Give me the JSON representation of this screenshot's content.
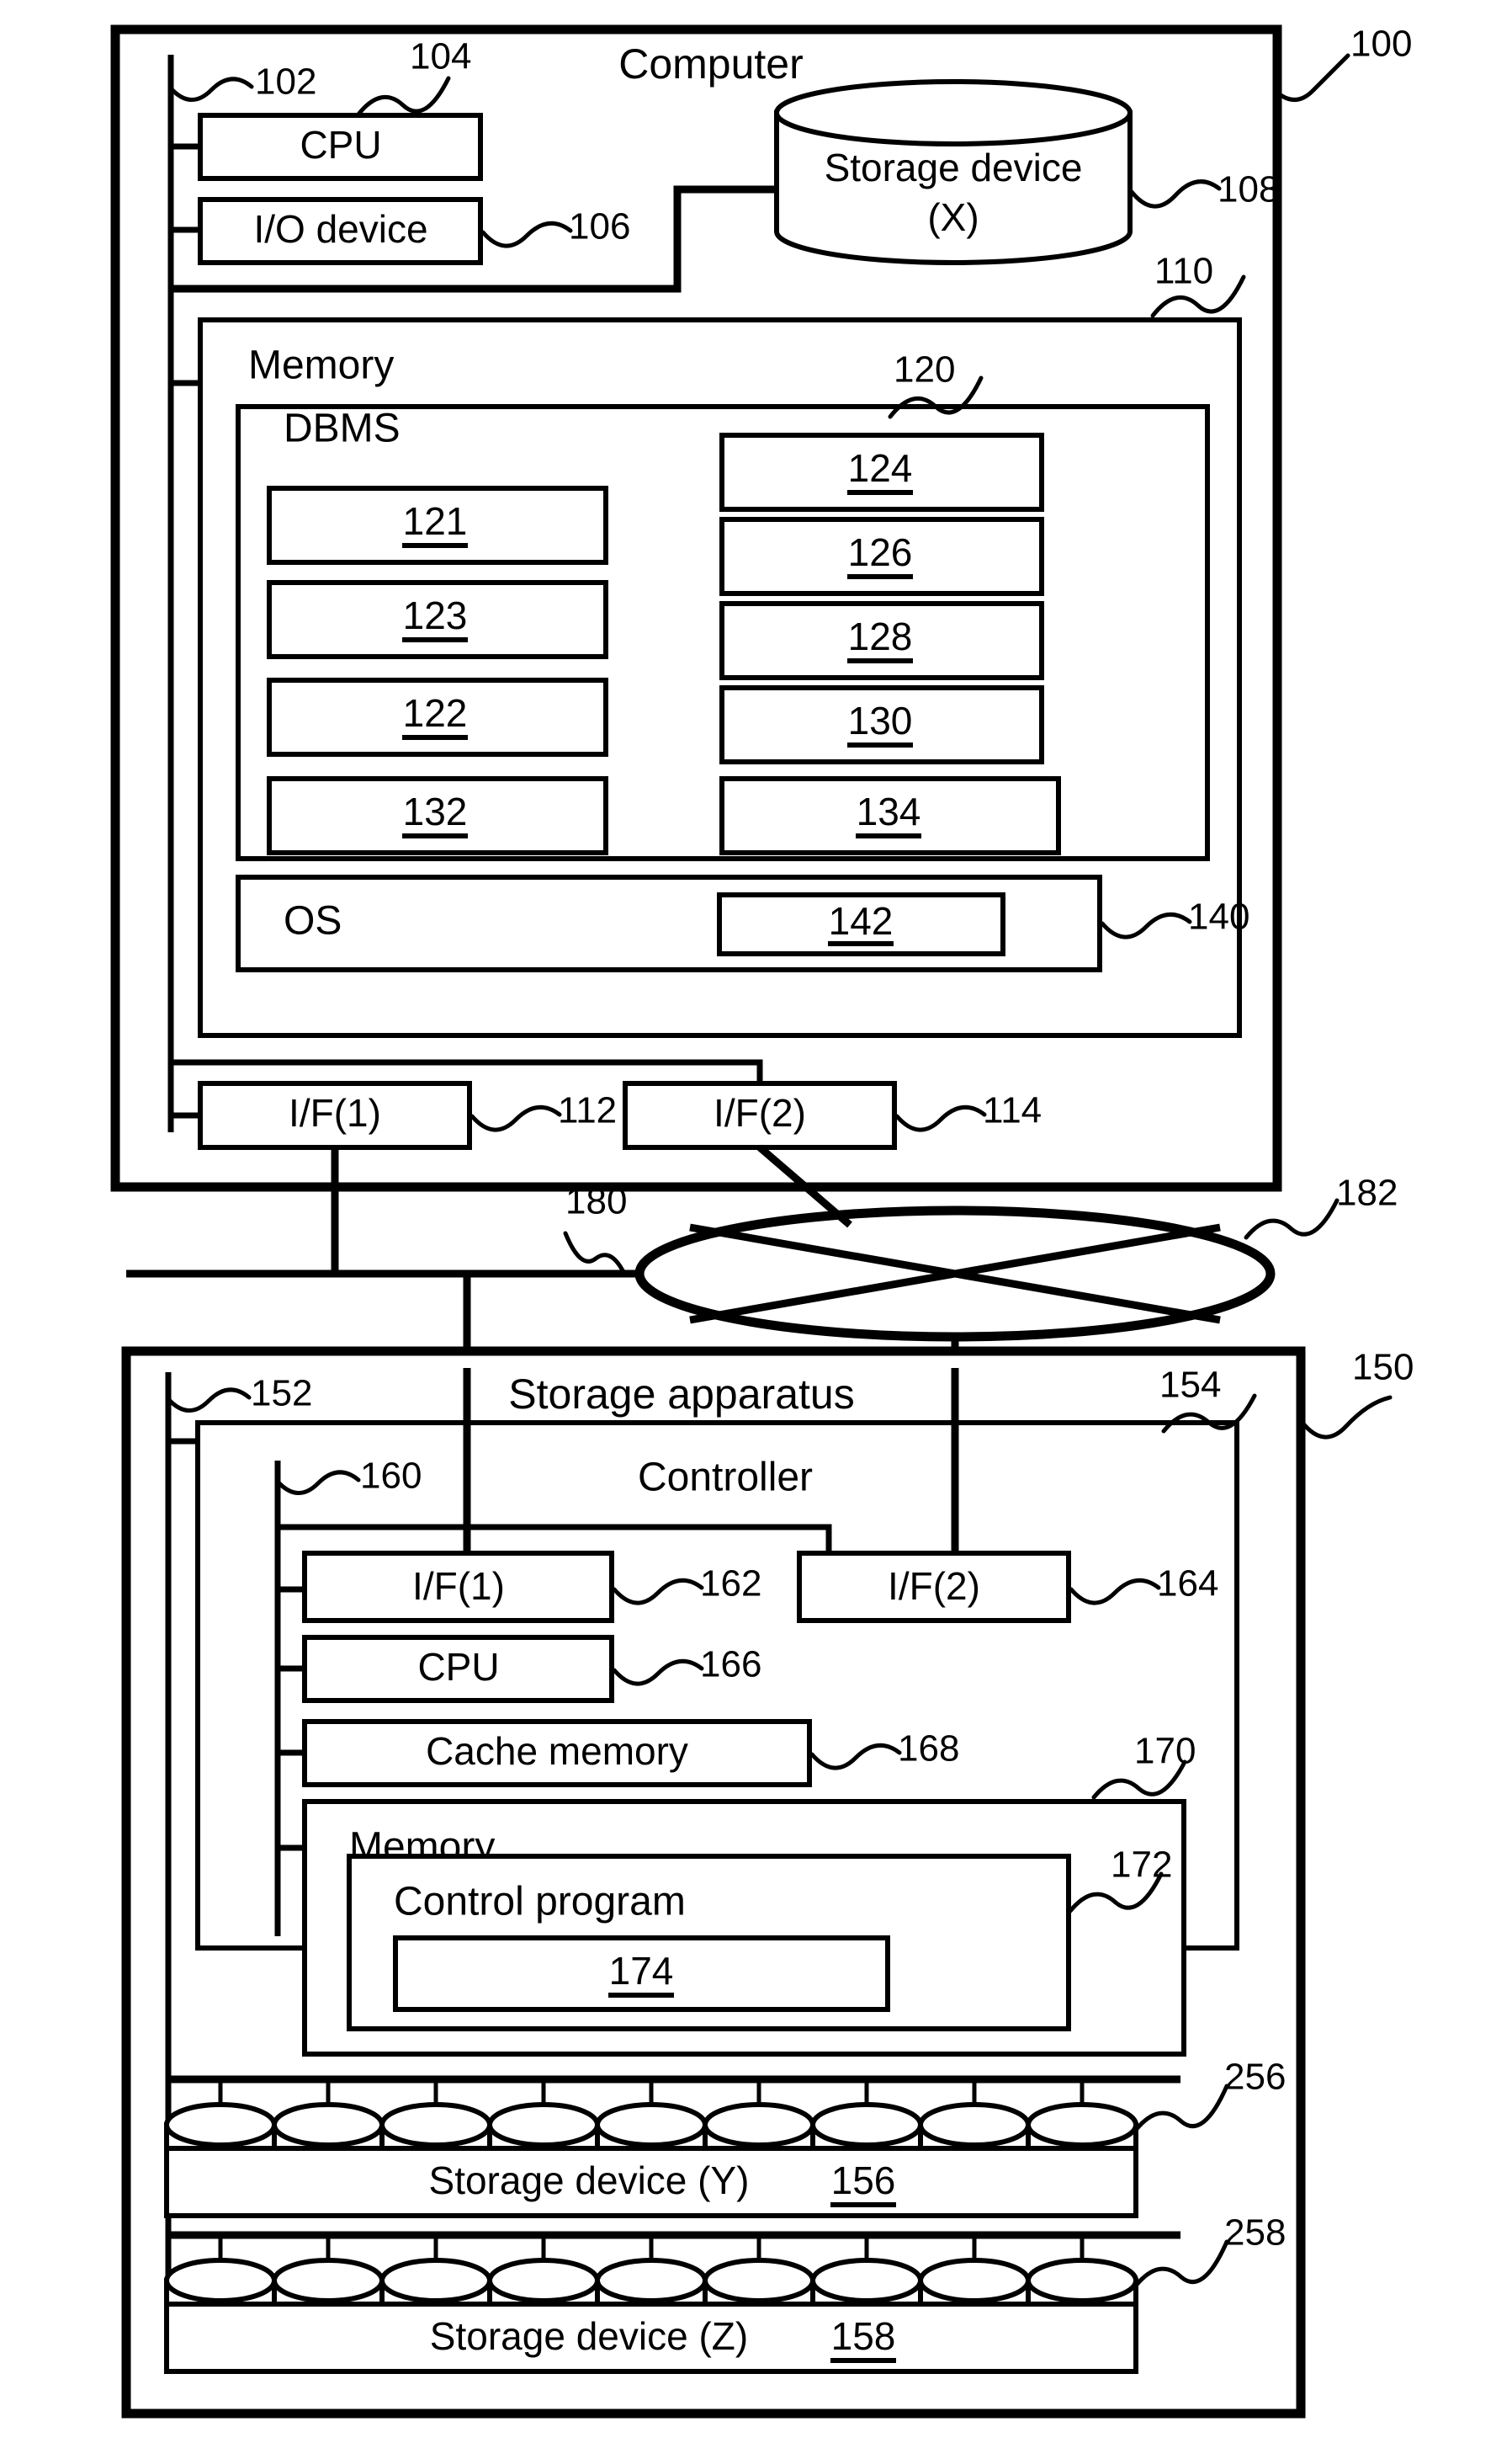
{
  "figure": {
    "top_ref": "100",
    "bottom_ref": "150",
    "network_ref": "182",
    "link_ref": "180"
  },
  "computer": {
    "title": "Computer",
    "bus_ref": "102",
    "cpu": {
      "label": "CPU",
      "ref": "104"
    },
    "io_device": {
      "label": "I/O device",
      "ref": "106"
    },
    "storage_device_x": {
      "line1": "Storage device",
      "line2": "(X)",
      "ref": "108"
    },
    "memory": {
      "label": "Memory",
      "ref": "110",
      "dbms": {
        "label": "DBMS",
        "ref": "120",
        "left_boxes": [
          {
            "ref": "121"
          },
          {
            "ref": "123"
          },
          {
            "ref": "122"
          },
          {
            "ref": "132"
          }
        ],
        "right_boxes": [
          {
            "ref": "124"
          },
          {
            "ref": "126"
          },
          {
            "ref": "128"
          },
          {
            "ref": "130"
          },
          {
            "ref": "134"
          }
        ]
      },
      "os": {
        "label": "OS",
        "ref": "140",
        "inner_ref": "142"
      }
    },
    "interfaces": [
      {
        "label": "I/F(1)",
        "ref": "112"
      },
      {
        "label": "I/F(2)",
        "ref": "114"
      }
    ]
  },
  "storage_apparatus": {
    "title": "Storage apparatus",
    "ref": "150",
    "bus_ref": "152",
    "controller": {
      "label": "Controller",
      "ref": "154",
      "bus_ref": "160",
      "interfaces": [
        {
          "label": "I/F(1)",
          "ref": "162"
        },
        {
          "label": "I/F(2)",
          "ref": "164"
        }
      ],
      "cpu": {
        "label": "CPU",
        "ref": "166"
      },
      "cache_memory": {
        "label": "Cache memory",
        "ref": "168"
      },
      "memory": {
        "label": "Memory",
        "ref": "170",
        "control_program": {
          "label": "Control program",
          "ref": "172",
          "inner_ref": "174"
        }
      }
    },
    "disk_rows": [
      {
        "label": "Storage device (Y)",
        "inner_ref": "156",
        "row_ref": "256",
        "disk_count": 9
      },
      {
        "label": "Storage device (Z)",
        "inner_ref": "158",
        "row_ref": "258",
        "disk_count": 9
      }
    ]
  }
}
